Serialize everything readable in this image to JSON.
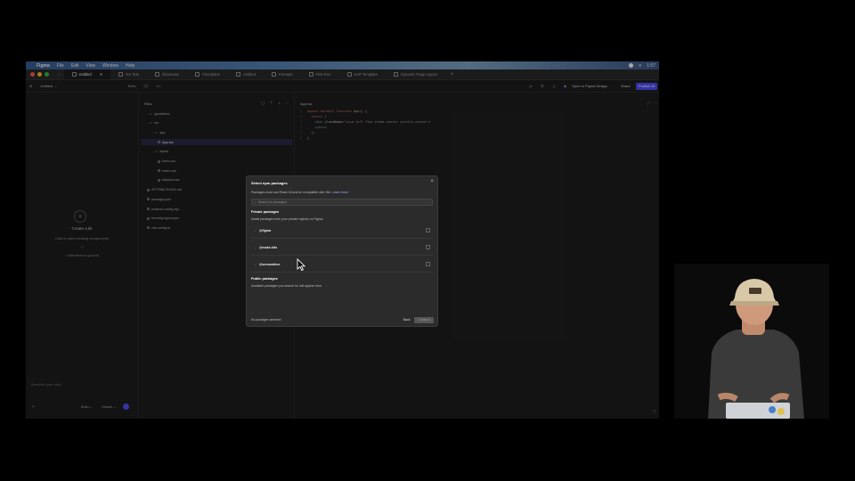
{
  "menubar": {
    "app": "Figma",
    "items": [
      "File",
      "Edit",
      "View",
      "Window",
      "Help"
    ],
    "time": "1:57"
  },
  "tabs": [
    {
      "label": "Untitled",
      "active": true
    },
    {
      "label": "DS Test"
    },
    {
      "label": "Showcase"
    },
    {
      "label": "Floorplans"
    },
    {
      "label": "Untitled"
    },
    {
      "label": "Prompts"
    },
    {
      "label": "First Run"
    },
    {
      "label": "SAP Template"
    },
    {
      "label": "Dynamic Page Layout"
    }
  ],
  "toolbar": {
    "file_name": "Untitled",
    "preview_label": "Beta",
    "open_in_figma": "Open in Figma Design",
    "share": "Share",
    "publish": "Publish kit"
  },
  "left_panel": {
    "title": "Create a kit",
    "subtitle": "Chat to start creating components",
    "or": "or",
    "add_items": "Add items to your kit",
    "chat_placeholder": "Describe your idea",
    "build_label": "Build",
    "model_label": "Default"
  },
  "files": {
    "header": "Files",
    "items": [
      {
        "label": "guidelines",
        "kind": "folder",
        "depth": 1
      },
      {
        "label": "src",
        "kind": "folder",
        "depth": 1
      },
      {
        "label": "app",
        "kind": "folder",
        "depth": 2
      },
      {
        "label": "App.tsx",
        "kind": "file",
        "depth": 3,
        "selected": true
      },
      {
        "label": "styles",
        "kind": "folder",
        "depth": 2
      },
      {
        "label": "fonts.css",
        "kind": "file",
        "depth": 3
      },
      {
        "label": "index.css",
        "kind": "file",
        "depth": 3
      },
      {
        "label": "tailwind.css",
        "kind": "file",
        "depth": 3
      },
      {
        "label": "ATTRIBUTIONS.md",
        "kind": "file",
        "depth": 1
      },
      {
        "label": "package.json",
        "kind": "file",
        "depth": 1
      },
      {
        "label": "postcss.config.mjs",
        "kind": "file",
        "depth": 1
      },
      {
        "label": "tsconfig.types.json",
        "kind": "file",
        "depth": 1
      },
      {
        "label": "vite.config.ts",
        "kind": "file",
        "depth": 1
      }
    ]
  },
  "editor": {
    "tab": "App.tsx",
    "lines": [
      "export default function App() {",
      "  return (",
      "    <div className=\"size-full flex items-center justify-center\">",
      "    </div>",
      "  );",
      "}"
    ]
  },
  "modal": {
    "title": "Select npm packages",
    "compat_text": "Packages must use React 18 and be compatible with Vite.",
    "learn_more": "Learn more",
    "search_placeholder": "Search for packages",
    "private_heading": "Private packages",
    "private_desc": "Install packages from your private registry on Figma.",
    "packages": [
      "@figma",
      "@make-kits",
      "@scrowntime"
    ],
    "public_heading": "Public packages",
    "public_desc": "Available packages you search for will appear here.",
    "status": "No packages selected",
    "back": "Back",
    "continue": "Continue"
  },
  "colors": {
    "accent": "#4f4fff",
    "background": "#1e1e1e",
    "modal": "#2b2b2b"
  }
}
